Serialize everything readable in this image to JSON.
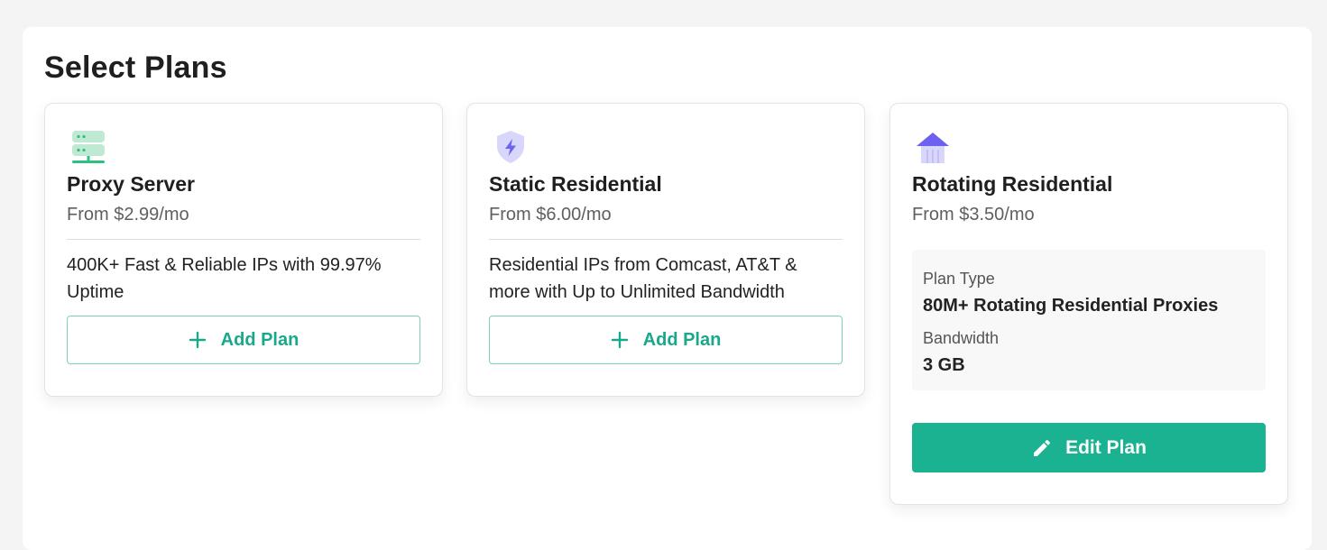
{
  "page": {
    "title": "Select Plans"
  },
  "plans": [
    {
      "icon": "server-icon",
      "name": "Proxy Server",
      "price": "From $2.99/mo",
      "description": "400K+ Fast & Reliable IPs with 99.97% Uptime",
      "button_label": "Add Plan"
    },
    {
      "icon": "shield-bolt-icon",
      "name": "Static Residential",
      "price": "From $6.00/mo",
      "description": "Residential IPs from Comcast, AT&T & more with Up to Unlimited Bandwidth",
      "button_label": "Add Plan"
    },
    {
      "icon": "house-icon",
      "name": "Rotating Residential",
      "price": "From $3.50/mo",
      "selected": {
        "plan_type_label": "Plan Type",
        "plan_type_value": "80M+ Rotating Residential Proxies",
        "bandwidth_label": "Bandwidth",
        "bandwidth_value": "3 GB"
      },
      "button_label": "Edit Plan"
    }
  ],
  "colors": {
    "accent": "#1ab291",
    "accent_border": "#7fd0b8",
    "icon_green": "#2fc07f",
    "icon_purple": "#6d62f0"
  }
}
